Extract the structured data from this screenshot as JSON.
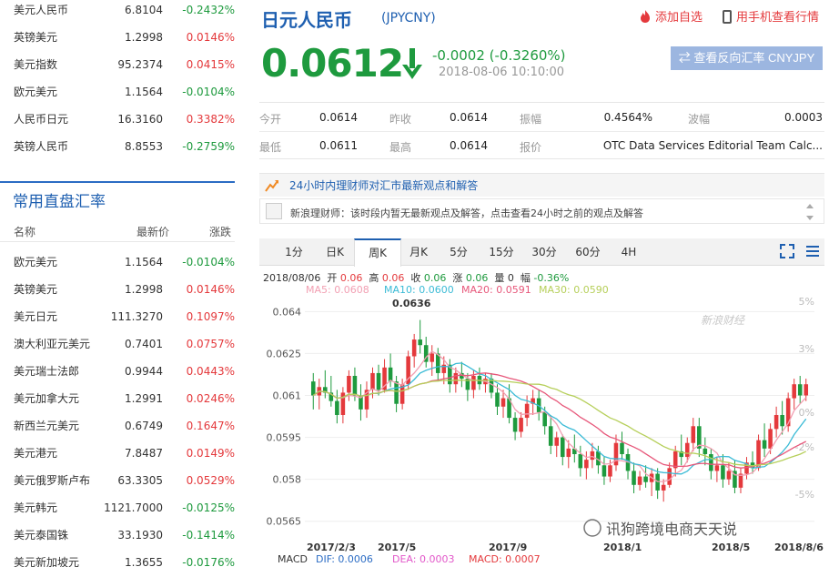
{
  "top_list": [
    {
      "name": "美元人民币",
      "price": "6.8104",
      "change": "-0.2432%",
      "dir": "down"
    },
    {
      "name": "英镑美元",
      "price": "1.2998",
      "change": "0.0146%",
      "dir": "up"
    },
    {
      "name": "美元指数",
      "price": "95.2374",
      "change": "0.0415%",
      "dir": "up"
    },
    {
      "name": "欧元美元",
      "price": "1.1564",
      "change": "-0.0104%",
      "dir": "down"
    },
    {
      "name": "人民币日元",
      "price": "16.3160",
      "change": "0.3382%",
      "dir": "up"
    },
    {
      "name": "英镑人民币",
      "price": "8.8553",
      "change": "-0.2759%",
      "dir": "down"
    }
  ],
  "common": {
    "title": "常用直盘汇率",
    "headers": {
      "name": "名称",
      "price": "最新价",
      "change": "涨跌"
    },
    "items": [
      {
        "name": "欧元美元",
        "price": "1.1564",
        "change": "-0.0104%",
        "dir": "down"
      },
      {
        "name": "英镑美元",
        "price": "1.2998",
        "change": "0.0146%",
        "dir": "up"
      },
      {
        "name": "美元日元",
        "price": "111.3270",
        "change": "0.1097%",
        "dir": "up"
      },
      {
        "name": "澳大利亚元美元",
        "price": "0.7401",
        "change": "0.0757%",
        "dir": "up"
      },
      {
        "name": "美元瑞士法郎",
        "price": "0.9944",
        "change": "0.0443%",
        "dir": "up"
      },
      {
        "name": "美元加拿大元",
        "price": "1.2991",
        "change": "0.0246%",
        "dir": "up"
      },
      {
        "name": "新西兰元美元",
        "price": "0.6749",
        "change": "0.1647%",
        "dir": "up"
      },
      {
        "name": "美元港元",
        "price": "7.8487",
        "change": "0.0149%",
        "dir": "up"
      },
      {
        "name": "美元俄罗斯卢布",
        "price": "63.3305",
        "change": "0.0529%",
        "dir": "up"
      },
      {
        "name": "美元韩元",
        "price": "1121.7000",
        "change": "-0.0125%",
        "dir": "down"
      },
      {
        "name": "美元泰国铢",
        "price": "33.1930",
        "change": "-0.1414%",
        "dir": "down"
      },
      {
        "name": "美元新加坡元",
        "price": "1.3655",
        "change": "-0.0176%",
        "dir": "down"
      }
    ]
  },
  "header": {
    "title": "日元人民币",
    "code": "(JPYCNY)",
    "add_watch": "添加自选",
    "mobile": "用手机查看行情",
    "price": "0.0612",
    "change": "-0.0002 (-0.3260%)",
    "time": "2018-08-06 10:10:00",
    "reverse_button": "查看反向汇率 CNYJPY"
  },
  "stats": {
    "open_label": "今开",
    "open": "0.0614",
    "prev_label": "昨收",
    "prev": "0.0614",
    "amp_label": "振幅",
    "amp": "0.4564%",
    "wave_label": "波幅",
    "wave": "0.0003",
    "low_label": "最低",
    "low": "0.0611",
    "high_label": "最高",
    "high": "0.0614",
    "quote_label": "报价",
    "quote": "OTC Data Services Editorial Team Calc..."
  },
  "notice": {
    "title": "24小时内理财师对汇市最新观点和解答",
    "comment": "新浪理财师：该时段内暂无最新观点及解答，点击查看24小时之前的观点及解答"
  },
  "tabs": [
    "1分",
    "日K",
    "周K",
    "月K",
    "5分",
    "15分",
    "30分",
    "60分",
    "4H"
  ],
  "active_tab": "周K",
  "candle_info": {
    "date": "2018/08/06",
    "open_label": "开",
    "open": "0.06",
    "high_label": "高",
    "high": "0.06",
    "close_label": "收",
    "close": "0.06",
    "chg_label": "涨",
    "chg": "0.06",
    "vol_label": "量",
    "vol": "0",
    "pct_label": "幅",
    "pct": "-0.36%"
  },
  "ma_info": {
    "ma5": "MA5: 0.0608",
    "ma10": "MA10: 0.0600",
    "ma20": "MA20: 0.0591",
    "ma30": "MA30: 0.0590"
  },
  "watermark": "新浪财经",
  "brand_watermark": "讯狗跨境电商天天说",
  "macd": {
    "label": "MACD",
    "dif": "DIF: 0.0006",
    "dea": "DEA: 0.0003",
    "macd": "MACD: 0.0007"
  },
  "colors": {
    "up": "#e4393c",
    "down": "#1e9a3e",
    "ma5": "#f29fb2",
    "ma10": "#3bbbd6",
    "ma20": "#e7577a",
    "ma30": "#b6cf5a"
  },
  "chart_data": {
    "type": "candlestick",
    "y_ticks": [
      "0.064",
      "0.0625",
      "0.061",
      "0.0595",
      "0.058",
      "0.0565"
    ],
    "ylim": [
      0.0561,
      0.0645
    ],
    "pct_ticks": [
      "5%",
      "3%",
      "0%",
      "-2%",
      "-5%"
    ],
    "x_ticks": [
      "2017/2/3",
      "2017/5",
      "2017/9",
      "2018/1",
      "2018/5",
      "2018/8/6"
    ],
    "high_annotation": "0.0636",
    "candles": [
      [
        0.0615,
        0.0618,
        0.0605,
        0.061
      ],
      [
        0.061,
        0.0616,
        0.0605,
        0.0613
      ],
      [
        0.0613,
        0.0619,
        0.0609,
        0.0611
      ],
      [
        0.0611,
        0.0617,
        0.0606,
        0.0608
      ],
      [
        0.0608,
        0.0612,
        0.06,
        0.0603
      ],
      [
        0.0603,
        0.0613,
        0.06,
        0.0611
      ],
      [
        0.0611,
        0.0619,
        0.0608,
        0.0617
      ],
      [
        0.0617,
        0.062,
        0.0608,
        0.061
      ],
      [
        0.061,
        0.0614,
        0.0601,
        0.0605
      ],
      [
        0.0605,
        0.0615,
        0.0602,
        0.0612
      ],
      [
        0.0612,
        0.062,
        0.0609,
        0.0618
      ],
      [
        0.0618,
        0.0621,
        0.061,
        0.0612
      ],
      [
        0.0612,
        0.0623,
        0.0611,
        0.062
      ],
      [
        0.062,
        0.0625,
        0.0613,
        0.0615
      ],
      [
        0.0615,
        0.0617,
        0.0604,
        0.0607
      ],
      [
        0.0607,
        0.0616,
        0.0605,
        0.0614
      ],
      [
        0.0614,
        0.0626,
        0.0612,
        0.0624
      ],
      [
        0.0624,
        0.0632,
        0.062,
        0.063
      ],
      [
        0.063,
        0.0637,
        0.0625,
        0.0628
      ],
      [
        0.0628,
        0.0631,
        0.062,
        0.0622
      ],
      [
        0.0622,
        0.0628,
        0.0617,
        0.0625
      ],
      [
        0.0625,
        0.0627,
        0.0615,
        0.0618
      ],
      [
        0.0618,
        0.0624,
        0.0614,
        0.0621
      ],
      [
        0.0621,
        0.0623,
        0.0611,
        0.0614
      ],
      [
        0.0614,
        0.062,
        0.0611,
        0.0618
      ],
      [
        0.0618,
        0.0622,
        0.0613,
        0.0616
      ],
      [
        0.0616,
        0.0618,
        0.0608,
        0.0612
      ],
      [
        0.0612,
        0.0619,
        0.0609,
        0.0617
      ],
      [
        0.0617,
        0.062,
        0.0612,
        0.0614
      ],
      [
        0.0614,
        0.0618,
        0.0611,
        0.0616
      ],
      [
        0.0616,
        0.0618,
        0.0609,
        0.0611
      ],
      [
        0.0611,
        0.0614,
        0.0603,
        0.0606
      ],
      [
        0.0606,
        0.0612,
        0.0602,
        0.0609
      ],
      [
        0.0609,
        0.0614,
        0.06,
        0.0602
      ],
      [
        0.0602,
        0.0604,
        0.0594,
        0.0597
      ],
      [
        0.0597,
        0.0604,
        0.0595,
        0.0602
      ],
      [
        0.0602,
        0.061,
        0.0599,
        0.0607
      ],
      [
        0.0607,
        0.0612,
        0.0603,
        0.0609
      ],
      [
        0.0609,
        0.0612,
        0.0601,
        0.0604
      ],
      [
        0.0604,
        0.0606,
        0.0596,
        0.0599
      ],
      [
        0.0599,
        0.0603,
        0.0589,
        0.0592
      ],
      [
        0.0592,
        0.0597,
        0.0588,
        0.0595
      ],
      [
        0.0595,
        0.0596,
        0.0585,
        0.0588
      ],
      [
        0.0588,
        0.0594,
        0.0584,
        0.0591
      ],
      [
        0.0591,
        0.0596,
        0.0586,
        0.0589
      ],
      [
        0.0589,
        0.0592,
        0.0581,
        0.0584
      ],
      [
        0.0584,
        0.059,
        0.058,
        0.0587
      ],
      [
        0.0587,
        0.0593,
        0.0584,
        0.059
      ],
      [
        0.059,
        0.0592,
        0.0582,
        0.0585
      ],
      [
        0.0585,
        0.0588,
        0.0578,
        0.0581
      ],
      [
        0.0581,
        0.0587,
        0.0579,
        0.0585
      ],
      [
        0.0585,
        0.0596,
        0.0583,
        0.0593
      ],
      [
        0.0593,
        0.0597,
        0.0587,
        0.0589
      ],
      [
        0.0589,
        0.0591,
        0.058,
        0.0583
      ],
      [
        0.0583,
        0.0586,
        0.0575,
        0.0578
      ],
      [
        0.0578,
        0.0583,
        0.0576,
        0.0581
      ],
      [
        0.0581,
        0.0585,
        0.0577,
        0.0579
      ],
      [
        0.0579,
        0.0584,
        0.0574,
        0.0582
      ],
      [
        0.0582,
        0.0584,
        0.0573,
        0.0576
      ],
      [
        0.0576,
        0.058,
        0.0572,
        0.0578
      ],
      [
        0.0578,
        0.0586,
        0.0577,
        0.0584
      ],
      [
        0.0584,
        0.0592,
        0.0581,
        0.059
      ],
      [
        0.059,
        0.0596,
        0.0585,
        0.0588
      ],
      [
        0.0588,
        0.0595,
        0.0586,
        0.0593
      ],
      [
        0.0593,
        0.0602,
        0.059,
        0.0599
      ],
      [
        0.0599,
        0.0602,
        0.0588,
        0.0591
      ],
      [
        0.0591,
        0.0595,
        0.0585,
        0.0589
      ],
      [
        0.0589,
        0.0591,
        0.058,
        0.0583
      ],
      [
        0.0583,
        0.0588,
        0.0579,
        0.0585
      ],
      [
        0.0585,
        0.0589,
        0.0577,
        0.058
      ],
      [
        0.058,
        0.0586,
        0.0578,
        0.0583
      ],
      [
        0.0583,
        0.0587,
        0.0575,
        0.0577
      ],
      [
        0.0577,
        0.0584,
        0.0575,
        0.0582
      ],
      [
        0.0582,
        0.0588,
        0.058,
        0.0586
      ],
      [
        0.0586,
        0.059,
        0.0582,
        0.0584
      ],
      [
        0.0584,
        0.0596,
        0.0583,
        0.0594
      ],
      [
        0.0594,
        0.06,
        0.0588,
        0.0591
      ],
      [
        0.0591,
        0.06,
        0.0589,
        0.0598
      ],
      [
        0.0598,
        0.0606,
        0.0595,
        0.0603
      ],
      [
        0.0603,
        0.0608,
        0.0596,
        0.0599
      ],
      [
        0.0599,
        0.0611,
        0.0597,
        0.0609
      ],
      [
        0.0609,
        0.0616,
        0.0605,
        0.0614
      ],
      [
        0.0614,
        0.0617,
        0.0607,
        0.061
      ],
      [
        0.061,
        0.0616,
        0.0608,
        0.0614
      ]
    ]
  }
}
